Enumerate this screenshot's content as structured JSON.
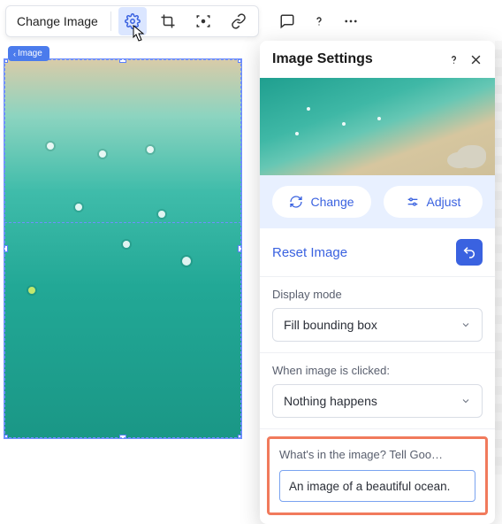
{
  "toolbar": {
    "change_image_label": "Change Image",
    "icons": {
      "gear": "gear-icon",
      "crop": "crop-icon",
      "focus": "focus-icon",
      "link": "link-icon",
      "comment": "comment-icon",
      "help": "help-icon",
      "more": "more-icon"
    }
  },
  "canvas": {
    "tag_label": "Image"
  },
  "panel": {
    "title": "Image Settings",
    "actions": {
      "change_label": "Change",
      "adjust_label": "Adjust"
    },
    "reset_label": "Reset Image",
    "display_mode": {
      "label": "Display mode",
      "value": "Fill bounding box"
    },
    "click_action": {
      "label": "When image is clicked:",
      "value": "Nothing happens"
    },
    "alt_text": {
      "label": "What's in the image? Tell Goo…",
      "value": "An image of a beautiful ocean."
    }
  },
  "colors": {
    "accent": "#3a62e0",
    "highlight": "#f17a5c"
  }
}
